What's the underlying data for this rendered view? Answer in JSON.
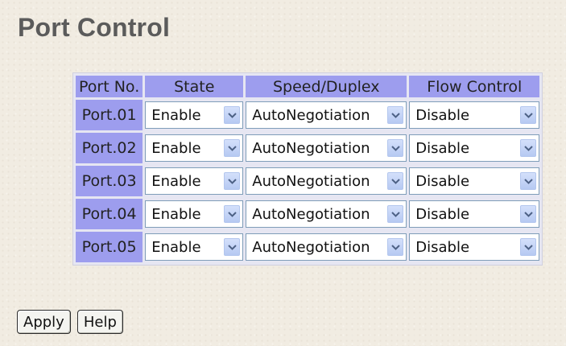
{
  "page": {
    "title": "Port Control"
  },
  "table": {
    "headers": {
      "port": "Port No.",
      "state": "State",
      "speed": "Speed/Duplex",
      "flow": "Flow Control"
    },
    "rows": [
      {
        "port": "Port.01",
        "state": "Enable",
        "speed": "AutoNegotiation",
        "flow": "Disable"
      },
      {
        "port": "Port.02",
        "state": "Enable",
        "speed": "AutoNegotiation",
        "flow": "Disable"
      },
      {
        "port": "Port.03",
        "state": "Enable",
        "speed": "AutoNegotiation",
        "flow": "Disable"
      },
      {
        "port": "Port.04",
        "state": "Enable",
        "speed": "AutoNegotiation",
        "flow": "Disable"
      },
      {
        "port": "Port.05",
        "state": "Enable",
        "speed": "AutoNegotiation",
        "flow": "Disable"
      }
    ]
  },
  "buttons": {
    "apply": "Apply",
    "help": "Help"
  },
  "icons": {
    "dropdown": "chevron-down-icon"
  },
  "colors": {
    "header_bg": "#9d9dee",
    "page_bg": "#f1ece2",
    "dropdown_button": "#c4d4f6"
  }
}
